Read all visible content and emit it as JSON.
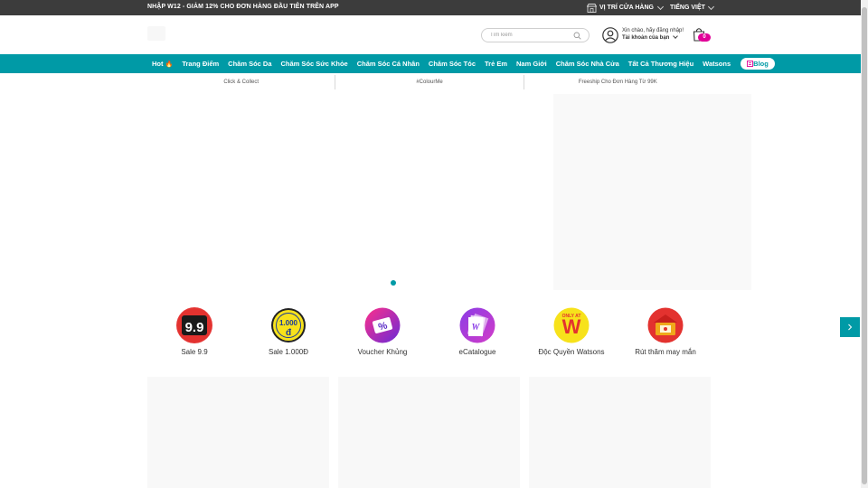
{
  "topbar": {
    "promo": "NHẬP W12 - GIẢM 12% CHO ĐƠN HÀNG ĐẦU TIÊN TRÊN APP",
    "store_label": "VỊ TRÍ CỬA HÀNG",
    "language_label": "TIẾNG VIỆT"
  },
  "header": {
    "search_placeholder": "Tìm kiếm",
    "greeting": "Xin chào, hãy đăng nhập!",
    "account_label": "Tài khoản của bạn",
    "cart_count": "0"
  },
  "nav": {
    "items": [
      {
        "label": "Hot"
      },
      {
        "label": "Trang Điểm"
      },
      {
        "label": "Chăm Sóc Da"
      },
      {
        "label": "Chăm Sóc Sức Khỏe"
      },
      {
        "label": "Chăm Sóc Cá Nhân"
      },
      {
        "label": "Chăm Sóc Tóc"
      },
      {
        "label": "Trẻ Em"
      },
      {
        "label": "Nam Giới"
      },
      {
        "label": "Chăm Sóc Nhà Cửa"
      },
      {
        "label": "Tất Cả Thương Hiệu"
      },
      {
        "label": "Watsons"
      }
    ],
    "blog_label": "Blog"
  },
  "usp": [
    {
      "label": "Click & Collect"
    },
    {
      "label": "#ColourMe"
    },
    {
      "label": "Freeship Cho Đơn Hàng Từ 99K"
    }
  ],
  "quick_links": [
    {
      "label": "Sale 9.9",
      "badge": "9.9"
    },
    {
      "label": "Sale 1.000Đ",
      "badge": "1.000"
    },
    {
      "label": "Voucher Khủng",
      "badge": "%"
    },
    {
      "label": "eCatalogue",
      "badge": "W"
    },
    {
      "label": "Độc Quyền Watsons",
      "badge": "W"
    },
    {
      "label": "Rút thăm may mắn",
      "badge": ""
    }
  ],
  "colors": {
    "brand_teal": "#009aa6",
    "cart_badge": "#e10098",
    "topbar": "#3c3c3c"
  },
  "icons": [
    "store-icon",
    "search-icon",
    "user-icon",
    "cart-icon",
    "flame-icon",
    "blog-icon",
    "chevron-right-icon"
  ]
}
